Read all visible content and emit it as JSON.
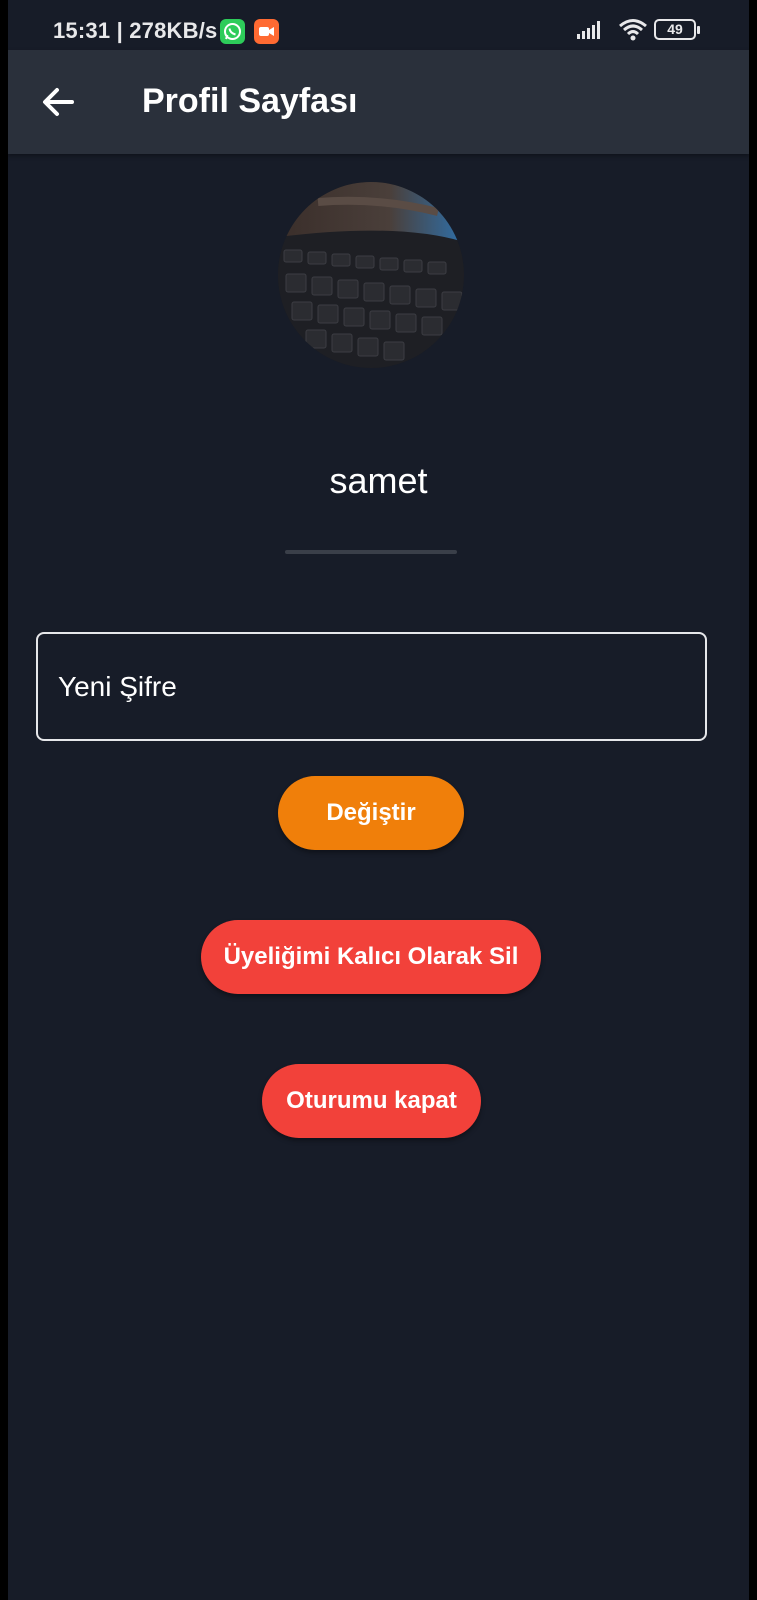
{
  "status_bar": {
    "time_speed": "15:31 | 278KB/s",
    "battery_level": "49",
    "icons": [
      "whatsapp-icon",
      "screen-recorder-icon",
      "signal-icon",
      "wifi-icon",
      "battery-icon"
    ]
  },
  "app_bar": {
    "title": "Profil Sayfası",
    "back_icon": "arrow-left-icon"
  },
  "profile": {
    "username": "samet"
  },
  "password": {
    "placeholder": "Yeni Şifre",
    "value": ""
  },
  "buttons": {
    "change_label": "Değiştir",
    "delete_label": "Üyeliğimi Kalıcı Olarak Sil",
    "logout_label": "Oturumu kapat"
  },
  "colors": {
    "background": "#171c28",
    "app_bar": "#2a303b",
    "change_button": "#f07f0a",
    "danger_button": "#f2413a"
  }
}
